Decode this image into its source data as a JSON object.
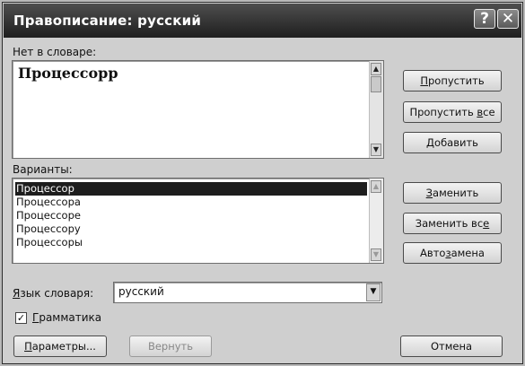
{
  "window": {
    "title": "Правописание: русский",
    "help_glyph": "?",
    "close_glyph": "✕"
  },
  "not_in_dictionary": {
    "label": "Нет в словаре:",
    "word": "Процессорр"
  },
  "suggestions": {
    "label": "Варианты:",
    "items": [
      "Процессор",
      "Процессора",
      "Процессоре",
      "Процессору",
      "Процессоры"
    ],
    "selected_index": 0
  },
  "language": {
    "label": "Язык словаря:",
    "value": "русский"
  },
  "grammar": {
    "label": "Грамматика",
    "checked": true
  },
  "buttons": {
    "skip": "Пропустить",
    "skip_all": "Пропустить все",
    "add": "Добавить",
    "change": "Заменить",
    "change_all": "Заменить все",
    "autocorrect": "Автозамена",
    "options": "Параметры...",
    "undo": "Вернуть",
    "cancel": "Отмена"
  }
}
